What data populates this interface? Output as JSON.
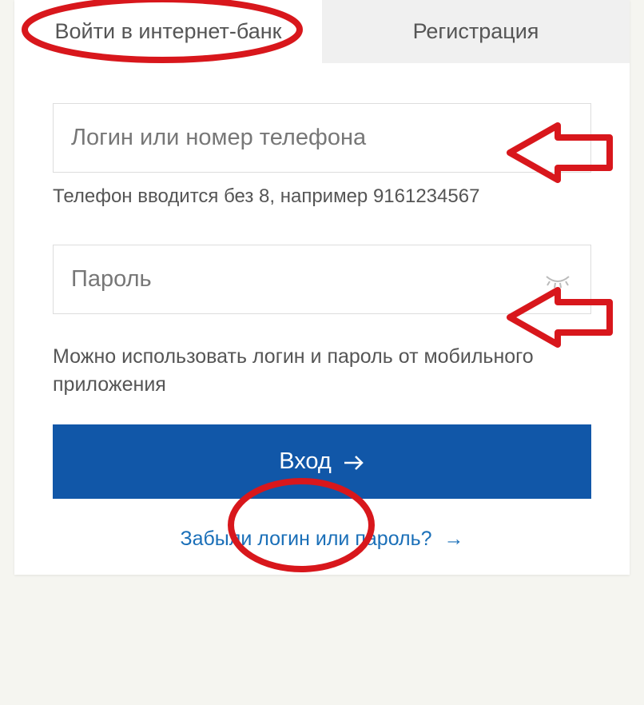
{
  "tabs": {
    "login": "Войти в интернет-банк",
    "register": "Регистрация"
  },
  "login_field": {
    "placeholder": "Логин или номер телефона",
    "helper": "Телефон вводится без 8, например 9161234567"
  },
  "password_field": {
    "placeholder": "Пароль"
  },
  "mobile_hint": "Можно использовать логин и пароль от мобильного приложения",
  "submit_label": "Вход",
  "forgot_link": "Забыли логин или пароль?"
}
